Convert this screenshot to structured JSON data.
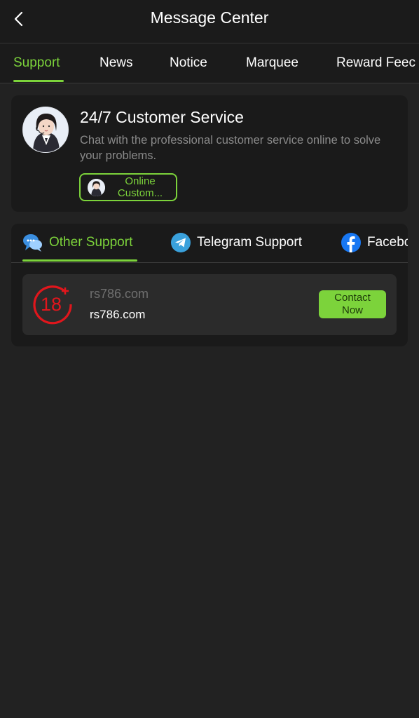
{
  "header": {
    "title": "Message Center",
    "back_icon": "chevron-left-icon"
  },
  "tabs": [
    {
      "label": "Support",
      "active": true
    },
    {
      "label": "News",
      "active": false
    },
    {
      "label": "Notice",
      "active": false
    },
    {
      "label": "Marquee",
      "active": false
    },
    {
      "label": "Reward Feec",
      "active": false
    }
  ],
  "customer_service": {
    "title": "24/7 Customer Service",
    "description": "Chat with the professional customer service online to solve your problems.",
    "button_line1": "Online",
    "button_line2": "Custom..."
  },
  "support": {
    "tabs": [
      {
        "label": "Other Support",
        "icon": "chat-bubble-icon",
        "active": true
      },
      {
        "label": "Telegram Support",
        "icon": "telegram-icon",
        "active": false
      },
      {
        "label": "Facebc",
        "icon": "facebook-icon",
        "active": false
      }
    ],
    "items": [
      {
        "name": "rs786.com",
        "value": "rs786.com",
        "icon": "18-plus-icon",
        "button_line1": "Contact",
        "button_line2": "Now"
      }
    ]
  },
  "colors": {
    "accent": "#7cd33b",
    "background": "#222222",
    "card": "#1a1a1a",
    "row": "#2b2b2b",
    "age_badge": "#e0161c"
  }
}
